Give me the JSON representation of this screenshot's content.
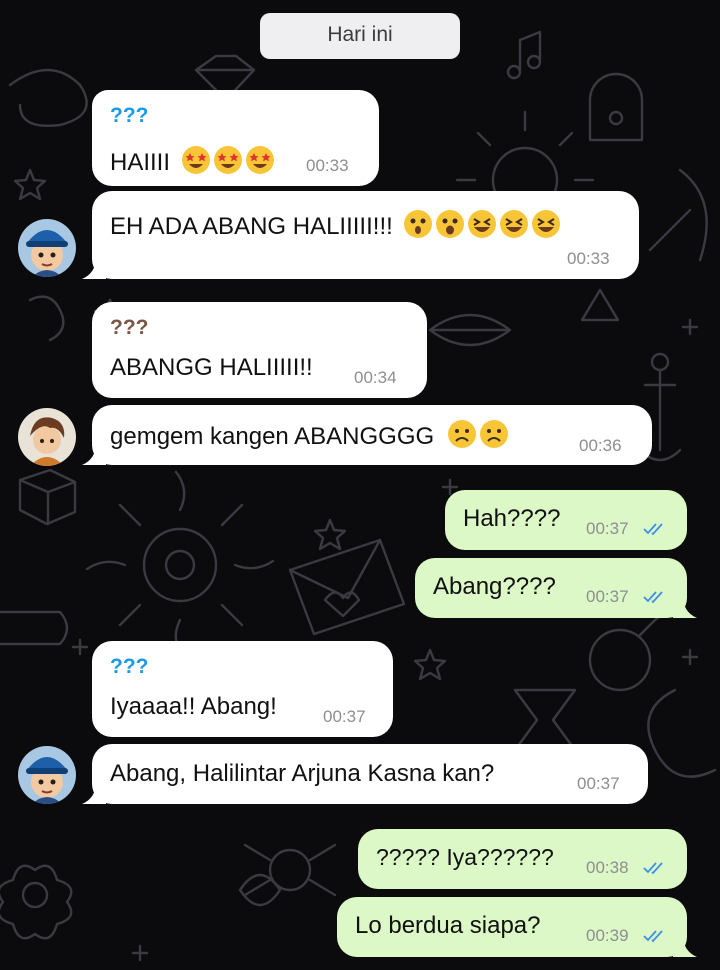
{
  "date_separator": "Hari ini",
  "colors": {
    "incoming_bubble": "#ffffff",
    "outgoing_bubble": "#dcf8c6",
    "sender_blue": "#1c9be5",
    "sender_brown": "#7a5646",
    "read_ticks": "#3c8fe8",
    "wallpaper": "#0b0b0d"
  },
  "messages": [
    {
      "direction": "in",
      "sender": "???",
      "text": "HAIIII",
      "emoji": [
        "star-struck-face-icon",
        "star-struck-face-icon",
        "star-struck-face-icon"
      ],
      "time": "00:33"
    },
    {
      "direction": "in",
      "avatar": "blue-hat-boy-avatar",
      "text": "EH ADA ABANG HALIIIII!!!",
      "emoji": [
        "astonished-face-icon",
        "open-mouth-face-icon",
        "laughing-face-icon",
        "laughing-face-icon",
        "laughing-face-icon"
      ],
      "time": "00:33"
    },
    {
      "direction": "in",
      "sender": "???",
      "text": "ABANGG HALIIIII!!",
      "time": "00:34"
    },
    {
      "direction": "in",
      "avatar": "brown-hair-boy-avatar",
      "text": "gemgem kangen ABANGGGG",
      "emoji": [
        "frowning-face-icon",
        "frowning-face-icon"
      ],
      "time": "00:36"
    },
    {
      "direction": "out",
      "text": "Hah????",
      "time": "00:37",
      "status": "read"
    },
    {
      "direction": "out",
      "text": "Abang????",
      "time": "00:37",
      "status": "read"
    },
    {
      "direction": "in",
      "sender": "???",
      "text": "Iyaaaa!! Abang!",
      "time": "00:37"
    },
    {
      "direction": "in",
      "avatar": "blue-hat-boy-avatar",
      "text": "Abang, Halilintar Arjuna Kasna kan?",
      "time": "00:37"
    },
    {
      "direction": "out",
      "text": "????? Iya??????",
      "time": "00:38",
      "status": "read"
    },
    {
      "direction": "out",
      "text": "Lo berdua siapa?",
      "time": "00:39",
      "status": "read"
    }
  ]
}
